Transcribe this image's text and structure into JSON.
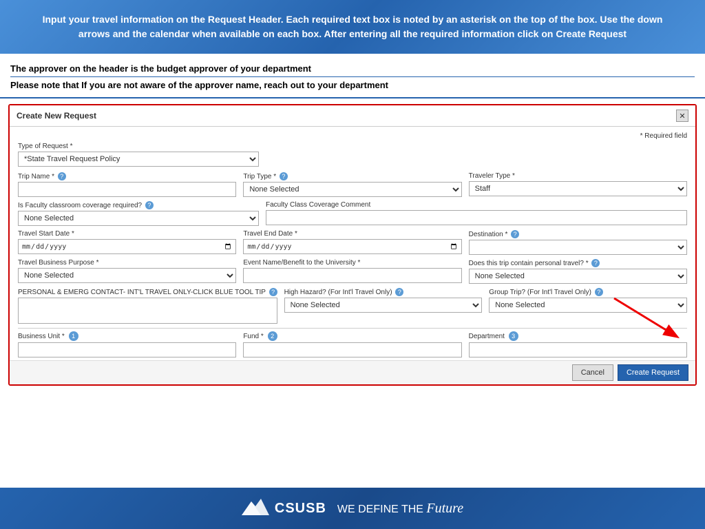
{
  "top_banner": {
    "text": "Input your travel information on the Request Header. Each required text box is noted by an asterisk on the top of the box.  Use the down arrows and the calendar when available on each box.  After entering all the required information click on Create Request"
  },
  "notices": [
    "The approver on the header is the budget approver of your department",
    "Please note that If you are not aware of the approver name, reach out to your department"
  ],
  "modal": {
    "title": "Create New Request",
    "close_label": "✕",
    "required_field_note": "* Required field",
    "type_of_request_label": "Type of Request *",
    "type_of_request_value": "*State Travel Request Policy",
    "trip_name_label": "Trip Name *",
    "trip_name_help": "?",
    "trip_type_label": "Trip Type *",
    "trip_type_help": "?",
    "trip_type_value": "None Selected",
    "traveler_type_label": "Traveler Type *",
    "traveler_type_value": "Staff",
    "faculty_coverage_label": "Is Faculty classroom coverage required?",
    "faculty_coverage_help": "?",
    "faculty_coverage_value": "None Selected",
    "faculty_comment_label": "Faculty Class Coverage Comment",
    "travel_start_label": "Travel Start Date *",
    "travel_start_placeholder": "MM/DD/YYYY",
    "travel_end_label": "Travel End Date *",
    "travel_end_placeholder": "MM/DD/YYYY",
    "destination_label": "Destination *",
    "destination_help": "?",
    "travel_business_label": "Travel Business Purpose *",
    "travel_business_value": "None Selected",
    "event_name_label": "Event Name/Benefit to the University *",
    "personal_travel_label": "Does this trip contain personal travel? *",
    "personal_travel_help": "?",
    "personal_travel_value": "None Selected",
    "emergency_contact_label": "PERSONAL & EMERG CONTACT- INT'L TRAVEL ONLY-CLICK BLUE TOOL TIP",
    "emergency_contact_help": "?",
    "high_hazard_label": "High Hazard? (For Int'l Travel Only)",
    "high_hazard_help": "?",
    "high_hazard_value": "None Selected",
    "group_trip_label": "Group Trip? (For Int'l Travel Only)",
    "group_trip_help": "?",
    "group_trip_value": "None Selected",
    "business_unit_label": "Business Unit *",
    "fund_label": "Fund *",
    "department_label": "Department",
    "cancel_label": "Cancel",
    "create_label": "Create Request"
  },
  "footer": {
    "csusb": "CSUSB",
    "slogan_plain": "WE DEFINE THE",
    "slogan_italic": "Future"
  }
}
